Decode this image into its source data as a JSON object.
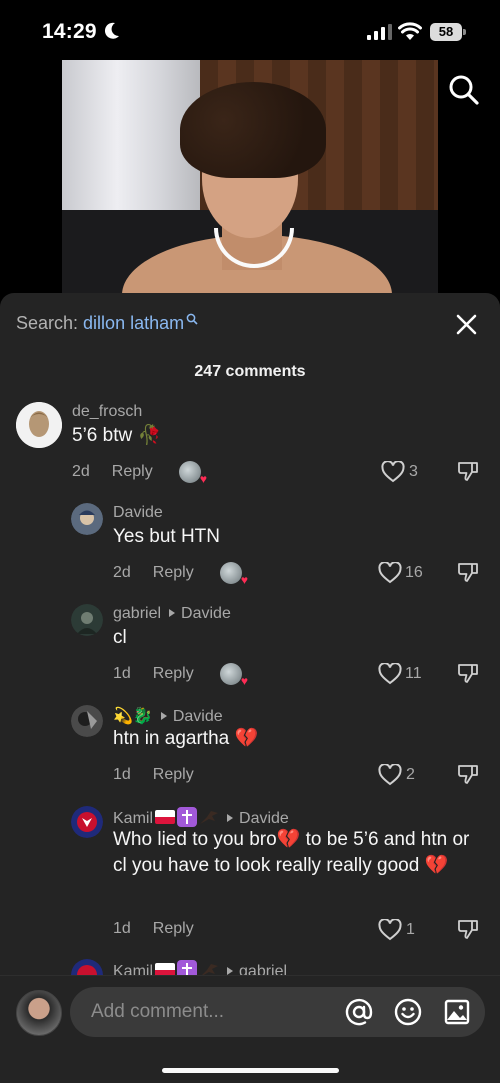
{
  "status_bar": {
    "time": "14:29",
    "battery": "58"
  },
  "header": {
    "search_prefix": "Search: ",
    "search_query": "dillon latham"
  },
  "comments_count": "247 comments",
  "comments": [
    {
      "user": "de_frosch",
      "reply_to": "",
      "text": "5’6 btw 🥀",
      "date": "2d",
      "reply_label": "Reply",
      "likes": "3"
    },
    {
      "user": "Davide",
      "reply_to": "",
      "text": "Yes but HTN",
      "date": "2d",
      "reply_label": "Reply",
      "likes": "16"
    },
    {
      "user": "gabriel",
      "reply_to": "Davide",
      "text": "cl",
      "date": "1d",
      "reply_label": "Reply",
      "likes": "11"
    },
    {
      "user": "💫🐉",
      "reply_to": "Davide",
      "text": "htn in agartha 💔",
      "date": "1d",
      "reply_label": "Reply",
      "likes": "2"
    },
    {
      "user": "Kamil",
      "reply_to": "Davide",
      "text": "Who lied to you bro💔 to be 5’6 and htn or cl you have to look really really good 💔",
      "date": "1d",
      "reply_label": "Reply",
      "likes": "1"
    },
    {
      "user": "Kamil",
      "reply_to": "gabriel",
      "text": "",
      "date": "",
      "reply_label": "",
      "likes": ""
    }
  ],
  "composer": {
    "placeholder": "Add comment..."
  },
  "colors": {
    "sheet_bg": "#242424",
    "link_blue": "#8ab8f0",
    "heart_red": "#fe2c55"
  },
  "icons": [
    "search-icon",
    "close-icon",
    "heart-icon",
    "dislike-icon",
    "at-icon",
    "emoji-icon",
    "image-icon",
    "moon-icon",
    "wifi-icon",
    "signal-icon"
  ]
}
